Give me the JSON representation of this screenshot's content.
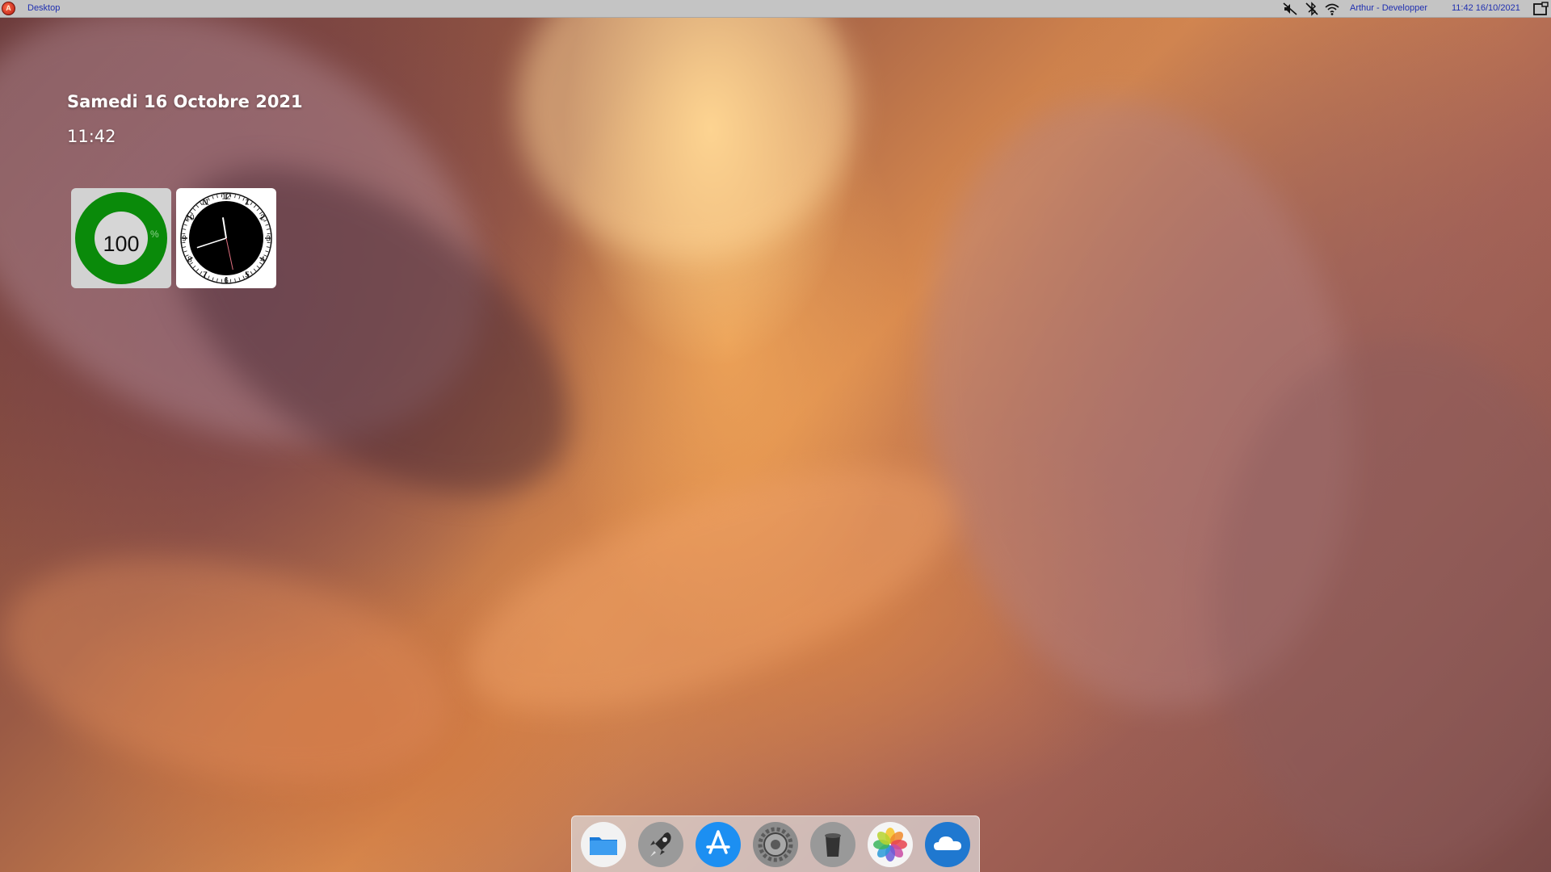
{
  "menubar": {
    "app_name": "Desktop",
    "logo_icon": "app-logo-icon",
    "tray_icons": [
      "sound-muted-icon",
      "bluetooth-off-icon",
      "wifi-icon"
    ],
    "user": "Arthur - Developper",
    "clock": "11:42 16/10/2021",
    "window_icon": "window-icon"
  },
  "desktop": {
    "date": "Samedi 16 Octobre 2021",
    "time": "11:42"
  },
  "widgets": {
    "battery": {
      "value": "100",
      "unit": "%",
      "level": 1.0,
      "color": "#0a8a0a"
    },
    "analog_clock": {
      "hour": 11,
      "minute": 42,
      "numbers": [
        "12",
        "1",
        "2",
        "3",
        "4",
        "5",
        "6",
        "7",
        "8",
        "9",
        "10",
        "11"
      ]
    }
  },
  "dock": {
    "items": [
      {
        "name": "finder",
        "icon": "folder-icon"
      },
      {
        "name": "launchpad",
        "icon": "rocket-icon"
      },
      {
        "name": "app-store",
        "icon": "app-store-icon"
      },
      {
        "name": "settings",
        "icon": "gear-icon"
      },
      {
        "name": "trash",
        "icon": "trash-icon"
      },
      {
        "name": "photos",
        "icon": "photos-icon"
      },
      {
        "name": "cloud",
        "icon": "cloud-icon"
      }
    ]
  }
}
